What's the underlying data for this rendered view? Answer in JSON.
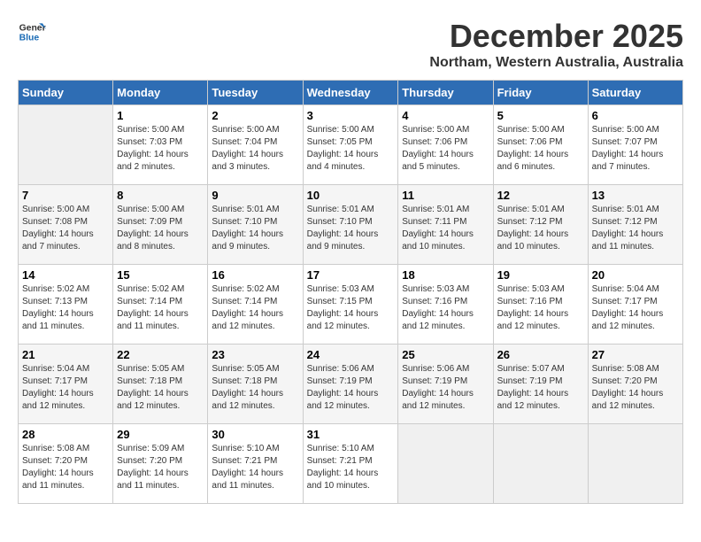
{
  "header": {
    "logo_line1": "General",
    "logo_line2": "Blue",
    "title": "December 2025",
    "subtitle": "Northam, Western Australia, Australia"
  },
  "calendar": {
    "days_of_week": [
      "Sunday",
      "Monday",
      "Tuesday",
      "Wednesday",
      "Thursday",
      "Friday",
      "Saturday"
    ],
    "weeks": [
      [
        {
          "day": "",
          "info": ""
        },
        {
          "day": "1",
          "info": "Sunrise: 5:00 AM\nSunset: 7:03 PM\nDaylight: 14 hours\nand 2 minutes."
        },
        {
          "day": "2",
          "info": "Sunrise: 5:00 AM\nSunset: 7:04 PM\nDaylight: 14 hours\nand 3 minutes."
        },
        {
          "day": "3",
          "info": "Sunrise: 5:00 AM\nSunset: 7:05 PM\nDaylight: 14 hours\nand 4 minutes."
        },
        {
          "day": "4",
          "info": "Sunrise: 5:00 AM\nSunset: 7:06 PM\nDaylight: 14 hours\nand 5 minutes."
        },
        {
          "day": "5",
          "info": "Sunrise: 5:00 AM\nSunset: 7:06 PM\nDaylight: 14 hours\nand 6 minutes."
        },
        {
          "day": "6",
          "info": "Sunrise: 5:00 AM\nSunset: 7:07 PM\nDaylight: 14 hours\nand 7 minutes."
        }
      ],
      [
        {
          "day": "7",
          "info": "Sunrise: 5:00 AM\nSunset: 7:08 PM\nDaylight: 14 hours\nand 7 minutes."
        },
        {
          "day": "8",
          "info": "Sunrise: 5:00 AM\nSunset: 7:09 PM\nDaylight: 14 hours\nand 8 minutes."
        },
        {
          "day": "9",
          "info": "Sunrise: 5:01 AM\nSunset: 7:10 PM\nDaylight: 14 hours\nand 9 minutes."
        },
        {
          "day": "10",
          "info": "Sunrise: 5:01 AM\nSunset: 7:10 PM\nDaylight: 14 hours\nand 9 minutes."
        },
        {
          "day": "11",
          "info": "Sunrise: 5:01 AM\nSunset: 7:11 PM\nDaylight: 14 hours\nand 10 minutes."
        },
        {
          "day": "12",
          "info": "Sunrise: 5:01 AM\nSunset: 7:12 PM\nDaylight: 14 hours\nand 10 minutes."
        },
        {
          "day": "13",
          "info": "Sunrise: 5:01 AM\nSunset: 7:12 PM\nDaylight: 14 hours\nand 11 minutes."
        }
      ],
      [
        {
          "day": "14",
          "info": "Sunrise: 5:02 AM\nSunset: 7:13 PM\nDaylight: 14 hours\nand 11 minutes."
        },
        {
          "day": "15",
          "info": "Sunrise: 5:02 AM\nSunset: 7:14 PM\nDaylight: 14 hours\nand 11 minutes."
        },
        {
          "day": "16",
          "info": "Sunrise: 5:02 AM\nSunset: 7:14 PM\nDaylight: 14 hours\nand 12 minutes."
        },
        {
          "day": "17",
          "info": "Sunrise: 5:03 AM\nSunset: 7:15 PM\nDaylight: 14 hours\nand 12 minutes."
        },
        {
          "day": "18",
          "info": "Sunrise: 5:03 AM\nSunset: 7:16 PM\nDaylight: 14 hours\nand 12 minutes."
        },
        {
          "day": "19",
          "info": "Sunrise: 5:03 AM\nSunset: 7:16 PM\nDaylight: 14 hours\nand 12 minutes."
        },
        {
          "day": "20",
          "info": "Sunrise: 5:04 AM\nSunset: 7:17 PM\nDaylight: 14 hours\nand 12 minutes."
        }
      ],
      [
        {
          "day": "21",
          "info": "Sunrise: 5:04 AM\nSunset: 7:17 PM\nDaylight: 14 hours\nand 12 minutes."
        },
        {
          "day": "22",
          "info": "Sunrise: 5:05 AM\nSunset: 7:18 PM\nDaylight: 14 hours\nand 12 minutes."
        },
        {
          "day": "23",
          "info": "Sunrise: 5:05 AM\nSunset: 7:18 PM\nDaylight: 14 hours\nand 12 minutes."
        },
        {
          "day": "24",
          "info": "Sunrise: 5:06 AM\nSunset: 7:19 PM\nDaylight: 14 hours\nand 12 minutes."
        },
        {
          "day": "25",
          "info": "Sunrise: 5:06 AM\nSunset: 7:19 PM\nDaylight: 14 hours\nand 12 minutes."
        },
        {
          "day": "26",
          "info": "Sunrise: 5:07 AM\nSunset: 7:19 PM\nDaylight: 14 hours\nand 12 minutes."
        },
        {
          "day": "27",
          "info": "Sunrise: 5:08 AM\nSunset: 7:20 PM\nDaylight: 14 hours\nand 12 minutes."
        }
      ],
      [
        {
          "day": "28",
          "info": "Sunrise: 5:08 AM\nSunset: 7:20 PM\nDaylight: 14 hours\nand 11 minutes."
        },
        {
          "day": "29",
          "info": "Sunrise: 5:09 AM\nSunset: 7:20 PM\nDaylight: 14 hours\nand 11 minutes."
        },
        {
          "day": "30",
          "info": "Sunrise: 5:10 AM\nSunset: 7:21 PM\nDaylight: 14 hours\nand 11 minutes."
        },
        {
          "day": "31",
          "info": "Sunrise: 5:10 AM\nSunset: 7:21 PM\nDaylight: 14 hours\nand 10 minutes."
        },
        {
          "day": "",
          "info": ""
        },
        {
          "day": "",
          "info": ""
        },
        {
          "day": "",
          "info": ""
        }
      ]
    ]
  }
}
